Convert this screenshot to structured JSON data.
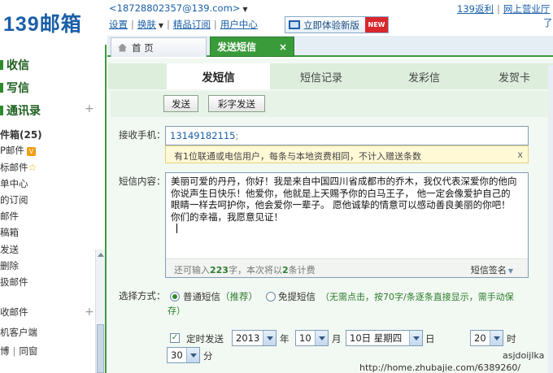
{
  "header": {
    "logo": "139邮箱",
    "account": "<18728802357@139.com>",
    "links": [
      "设置",
      "换肤",
      "精品订阅",
      "用户中心"
    ],
    "new_version_btn": "立即体验新版",
    "new_badge": "NEW",
    "right_links": [
      "139返利",
      "网上营业厅"
    ],
    "right_partial": "了"
  },
  "tabs": {
    "home": "首 页",
    "sms": "发送短信",
    "close": "×"
  },
  "sidebar": {
    "inbox": "收信",
    "compose": "写信",
    "contacts": "通讯录",
    "plus": "+",
    "folders_title": "件箱(25)",
    "items": [
      "P邮件",
      "标邮件",
      "单中心",
      "的订阅",
      "邮件",
      "稿箱",
      "发送",
      "删除",
      "扱邮件"
    ],
    "vip_badge": "V",
    "star": "☆",
    "section2": "收邮件",
    "client": "机客户端",
    "weibo": "博",
    "classmates": "同窗"
  },
  "subtabs": [
    "发短信",
    "短信记录",
    "发彩信",
    "发贺卡"
  ],
  "actions": {
    "send": "发送",
    "mms_send": "彩字发送"
  },
  "form": {
    "recipient_label": "接收手机：",
    "recipient_value": "13149182115",
    "recipient_sep": ";",
    "notice": "有1位联通或电信用户，每条与本地资费相同，不计入赠送条数",
    "notice_close": "x",
    "content_label": "短信内容：",
    "content": "美丽可爱的丹丹，你好！我是来自中国四川省成都市的乔木，我仅代表深爱你的他向你说声生日快乐！他爱你，他就是上天赐予你的白马王子， 他一定会像爱护自己的眼睛一样去呵护你，他会爱你一辈子。 愿他诚挚的情意可以感动善良美丽的你吧！你们的幸福，我愿意见证！",
    "counter_prefix": "还可输入",
    "counter_chars": "223",
    "counter_mid": "字，本次将以",
    "counter_count": "2",
    "counter_suffix": "条计费",
    "signature": "短信签名",
    "method_label": "选择方式：",
    "method_normal": "普通短信",
    "method_normal_note": "（推荐）",
    "method_free": "免提短信",
    "method_free_note": "（无需点击，按70字/条逐条直接显示，需手动保",
    "method_free_note2": "存）",
    "scheduled_label": "定时发送",
    "year": "2013",
    "year_unit": "年",
    "month": "10",
    "month_unit": "月",
    "day": "10日 星期四",
    "day_unit": "日",
    "hour": "20",
    "hour_unit": "时",
    "minute": "30",
    "minute_unit": "分"
  },
  "watermark": {
    "name": "asjdoijlka",
    "url": "http://home.zhubajie.com/6389260/"
  },
  "colors": {
    "brand_blue": "#1a5fa8",
    "accent_green": "#3a9b3a",
    "new_red": "#d8262e"
  }
}
